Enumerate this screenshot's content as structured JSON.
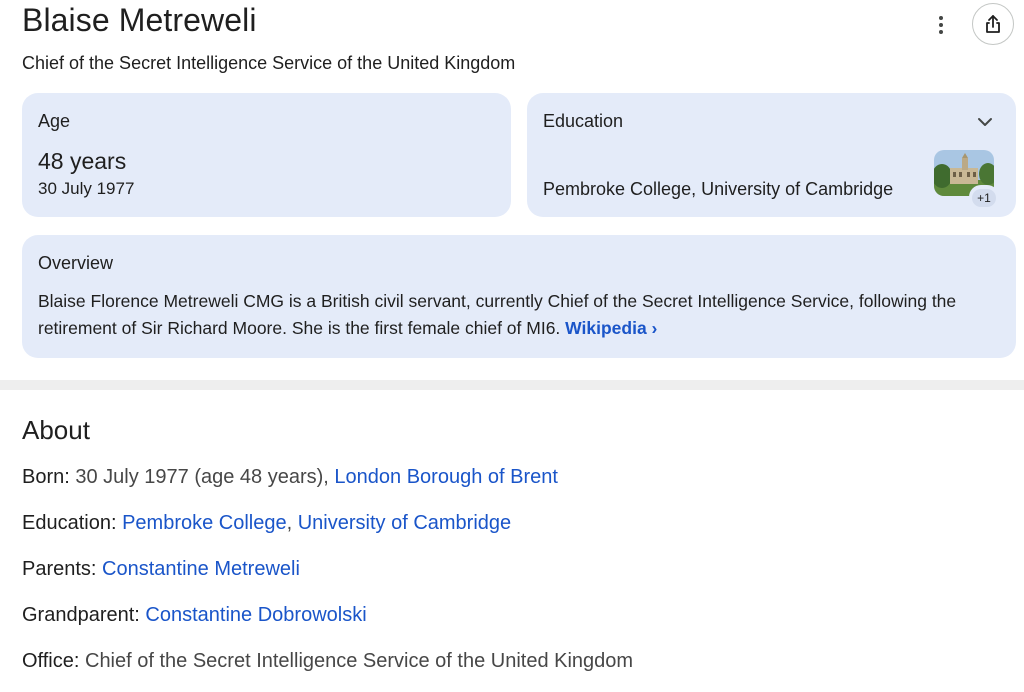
{
  "header": {
    "title": "Blaise Metreweli",
    "subtitle": "Chief of the Secret Intelligence Service of the United Kingdom"
  },
  "icons": {
    "menu": "more-vert-icon",
    "share": "share-icon",
    "expand": "chevron-down-icon"
  },
  "age_card": {
    "label": "Age",
    "value": "48 years",
    "date": "30 July 1977"
  },
  "education_card": {
    "label": "Education",
    "value": "Pembroke College, University of Cambridge",
    "more_badge": "+1"
  },
  "overview": {
    "label": "Overview",
    "text": "Blaise Florence Metreweli CMG is a British civil servant, currently Chief of the Secret Intelligence Service, following the retirement of Sir Richard Moore. She is the first female chief of MI6. ",
    "link": "Wikipedia ›"
  },
  "about": {
    "title": "About",
    "born": {
      "key": "Born:",
      "text": " 30 July 1977 (age 48 years), ",
      "link": "London Borough of Brent"
    },
    "education": {
      "key": "Education:",
      "link1": "Pembroke College",
      "sep": ", ",
      "link2": "University of Cambridge"
    },
    "parents": {
      "key": "Parents:",
      "link": "Constantine Metreweli"
    },
    "grandparent": {
      "key": "Grandparent:",
      "link": "Constantine Dobrowolski"
    },
    "office": {
      "key": "Office:",
      "text": " Chief of the Secret Intelligence Service of the United Kingdom"
    }
  },
  "colors": {
    "card_bg": "#e4ebf9",
    "link": "#1a55c9",
    "text": "#1f1f1f"
  }
}
